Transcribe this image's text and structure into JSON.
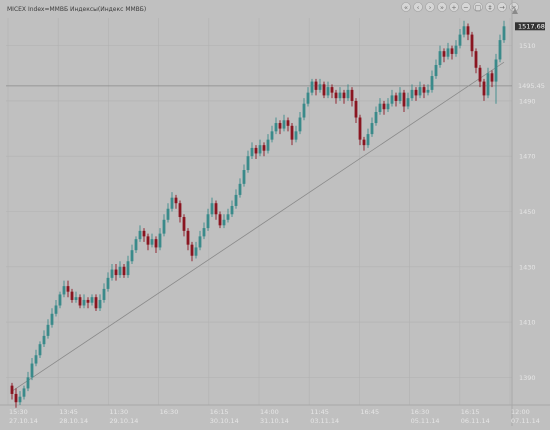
{
  "chart_data": {
    "type": "candlestick",
    "title": "MICEX Index=ММВБ Индексы(Индекс ММВБ)",
    "ylim": [
      1380,
      1520
    ],
    "y_ticks": [
      1390,
      1410,
      1430,
      1450,
      1470,
      1490,
      1510
    ],
    "x_tick_labels": [
      {
        "time": "15:30",
        "date": "27.10.14"
      },
      {
        "time": "13:45",
        "date": "28.10.14"
      },
      {
        "time": "11:30",
        "date": "29.10.14"
      },
      {
        "time": "16:30",
        "date": ""
      },
      {
        "time": "16:15",
        "date": "30.10.14"
      },
      {
        "time": "14:00",
        "date": "31.10.14"
      },
      {
        "time": "11:45",
        "date": "03.11.14"
      },
      {
        "time": "16:45",
        "date": ""
      },
      {
        "time": "16:30",
        "date": "05.11.14"
      },
      {
        "time": "16:15",
        "date": "06.11.14"
      },
      {
        "time": "12:00",
        "date": "07.11.14"
      }
    ],
    "current_price_label": "1517.68",
    "horizontal_line_label": "1495.45",
    "horizontal_line_value": 1495.45,
    "trendline": {
      "from": 1385,
      "to": 1504
    },
    "candles": [
      [
        1387,
        1384,
        1388,
        1382
      ],
      [
        1384,
        1381,
        1386,
        1379
      ],
      [
        1381,
        1383,
        1385,
        1380
      ],
      [
        1383,
        1386,
        1387,
        1382
      ],
      [
        1386,
        1390,
        1392,
        1385
      ],
      [
        1390,
        1395,
        1397,
        1389
      ],
      [
        1395,
        1398,
        1400,
        1394
      ],
      [
        1398,
        1402,
        1403,
        1397
      ],
      [
        1402,
        1405,
        1407,
        1401
      ],
      [
        1405,
        1409,
        1411,
        1404
      ],
      [
        1409,
        1413,
        1415,
        1408
      ],
      [
        1413,
        1416,
        1418,
        1412
      ],
      [
        1416,
        1420,
        1421,
        1415
      ],
      [
        1420,
        1423,
        1425,
        1419
      ],
      [
        1423,
        1421,
        1425,
        1419
      ],
      [
        1421,
        1418,
        1422,
        1417
      ],
      [
        1418,
        1419,
        1421,
        1417
      ],
      [
        1419,
        1416,
        1420,
        1415
      ],
      [
        1416,
        1418,
        1420,
        1415
      ],
      [
        1418,
        1417,
        1419,
        1415
      ],
      [
        1417,
        1419,
        1420,
        1416
      ],
      [
        1419,
        1415,
        1420,
        1414
      ],
      [
        1415,
        1418,
        1420,
        1414
      ],
      [
        1418,
        1422,
        1424,
        1417
      ],
      [
        1422,
        1426,
        1428,
        1421
      ],
      [
        1426,
        1429,
        1431,
        1425
      ],
      [
        1429,
        1427,
        1431,
        1425
      ],
      [
        1427,
        1430,
        1432,
        1426
      ],
      [
        1430,
        1427,
        1431,
        1426
      ],
      [
        1427,
        1432,
        1434,
        1426
      ],
      [
        1432,
        1436,
        1438,
        1431
      ],
      [
        1436,
        1440,
        1441,
        1435
      ],
      [
        1440,
        1443,
        1445,
        1439
      ],
      [
        1443,
        1441,
        1444,
        1439
      ],
      [
        1441,
        1438,
        1442,
        1436
      ],
      [
        1438,
        1440,
        1442,
        1437
      ],
      [
        1440,
        1437,
        1441,
        1435
      ],
      [
        1437,
        1442,
        1444,
        1436
      ],
      [
        1442,
        1447,
        1449,
        1441
      ],
      [
        1447,
        1451,
        1453,
        1446
      ],
      [
        1451,
        1455,
        1457,
        1450
      ],
      [
        1455,
        1453,
        1456,
        1451
      ],
      [
        1453,
        1448,
        1454,
        1446
      ],
      [
        1448,
        1443,
        1449,
        1441
      ],
      [
        1443,
        1438,
        1444,
        1436
      ],
      [
        1438,
        1434,
        1439,
        1432
      ],
      [
        1434,
        1437,
        1439,
        1433
      ],
      [
        1437,
        1441,
        1443,
        1436
      ],
      [
        1441,
        1444,
        1446,
        1440
      ],
      [
        1444,
        1449,
        1451,
        1443
      ],
      [
        1449,
        1453,
        1455,
        1448
      ],
      [
        1453,
        1449,
        1454,
        1447
      ],
      [
        1449,
        1445,
        1450,
        1444
      ],
      [
        1445,
        1447,
        1449,
        1444
      ],
      [
        1447,
        1449,
        1451,
        1446
      ],
      [
        1449,
        1452,
        1454,
        1448
      ],
      [
        1452,
        1456,
        1458,
        1451
      ],
      [
        1456,
        1460,
        1462,
        1455
      ],
      [
        1460,
        1465,
        1467,
        1459
      ],
      [
        1465,
        1470,
        1472,
        1464
      ],
      [
        1470,
        1473,
        1475,
        1469
      ],
      [
        1473,
        1471,
        1474,
        1469
      ],
      [
        1471,
        1474,
        1476,
        1470
      ],
      [
        1474,
        1472,
        1475,
        1470
      ],
      [
        1472,
        1476,
        1478,
        1471
      ],
      [
        1476,
        1479,
        1481,
        1475
      ],
      [
        1479,
        1482,
        1484,
        1478
      ],
      [
        1482,
        1480,
        1483,
        1478
      ],
      [
        1480,
        1483,
        1485,
        1479
      ],
      [
        1483,
        1481,
        1484,
        1479
      ],
      [
        1481,
        1476,
        1482,
        1474
      ],
      [
        1476,
        1479,
        1481,
        1475
      ],
      [
        1479,
        1484,
        1486,
        1478
      ],
      [
        1484,
        1489,
        1491,
        1483
      ],
      [
        1489,
        1493,
        1495,
        1488
      ],
      [
        1493,
        1497,
        1498,
        1492
      ],
      [
        1497,
        1494,
        1498,
        1492
      ],
      [
        1494,
        1496,
        1498,
        1493
      ],
      [
        1496,
        1492,
        1497,
        1491
      ],
      [
        1492,
        1495,
        1497,
        1491
      ],
      [
        1495,
        1493,
        1496,
        1491
      ],
      [
        1493,
        1491,
        1494,
        1489
      ],
      [
        1491,
        1493,
        1495,
        1490
      ],
      [
        1493,
        1491,
        1494,
        1489
      ],
      [
        1491,
        1494,
        1496,
        1490
      ],
      [
        1494,
        1490,
        1495,
        1488
      ],
      [
        1490,
        1484,
        1491,
        1482
      ],
      [
        1484,
        1476,
        1485,
        1474
      ],
      [
        1476,
        1474,
        1477,
        1472
      ],
      [
        1474,
        1478,
        1480,
        1473
      ],
      [
        1478,
        1482,
        1484,
        1477
      ],
      [
        1482,
        1486,
        1488,
        1481
      ],
      [
        1486,
        1489,
        1491,
        1485
      ],
      [
        1489,
        1487,
        1490,
        1485
      ],
      [
        1487,
        1489,
        1491,
        1486
      ],
      [
        1489,
        1492,
        1494,
        1488
      ],
      [
        1492,
        1490,
        1493,
        1488
      ],
      [
        1490,
        1493,
        1495,
        1489
      ],
      [
        1493,
        1488,
        1494,
        1486
      ],
      [
        1488,
        1491,
        1493,
        1487
      ],
      [
        1491,
        1494,
        1496,
        1490
      ],
      [
        1494,
        1492,
        1495,
        1490
      ],
      [
        1492,
        1495,
        1497,
        1491
      ],
      [
        1495,
        1493,
        1496,
        1491
      ],
      [
        1493,
        1494,
        1496,
        1492
      ],
      [
        1494,
        1499,
        1501,
        1493
      ],
      [
        1499,
        1503,
        1505,
        1498
      ],
      [
        1503,
        1508,
        1510,
        1502
      ],
      [
        1508,
        1506,
        1509,
        1504
      ],
      [
        1506,
        1509,
        1511,
        1505
      ],
      [
        1509,
        1507,
        1510,
        1505
      ],
      [
        1507,
        1510,
        1512,
        1506
      ],
      [
        1510,
        1514,
        1516,
        1509
      ],
      [
        1514,
        1517,
        1519,
        1513
      ],
      [
        1517,
        1514,
        1518,
        1512
      ],
      [
        1514,
        1508,
        1515,
        1506
      ],
      [
        1508,
        1502,
        1509,
        1500
      ],
      [
        1502,
        1497,
        1503,
        1495
      ],
      [
        1497,
        1492,
        1498,
        1490
      ],
      [
        1492,
        1500,
        1502,
        1491
      ],
      [
        1500,
        1497,
        1501,
        1495
      ],
      [
        1497,
        1505,
        1507,
        1489
      ],
      [
        1505,
        1512,
        1514,
        1504
      ],
      [
        1512,
        1517,
        1519,
        1511
      ]
    ]
  },
  "toolbar": {
    "buttons": [
      {
        "glyph": "«",
        "name": "first-page-button"
      },
      {
        "glyph": "‹",
        "name": "prev-page-button"
      },
      {
        "glyph": "›",
        "name": "next-page-button"
      },
      {
        "glyph": "»",
        "name": "last-page-button"
      },
      {
        "glyph": "+",
        "name": "zoom-in-button"
      },
      {
        "glyph": "−",
        "name": "zoom-out-button"
      },
      {
        "glyph": "□",
        "name": "fit-button"
      },
      {
        "glyph": "‡",
        "name": "scale-button"
      },
      {
        "glyph": "→",
        "name": "scroll-end-button"
      },
      {
        "glyph": "×",
        "name": "close-button"
      }
    ]
  },
  "colors": {
    "bull": "#3a8a8a",
    "bear": "#8a1520",
    "grid": "#b2b2b2",
    "axis": "#a8a8a8",
    "text": "#e6e6e6",
    "line": "#8a8a8a",
    "price_box": "#333333"
  }
}
